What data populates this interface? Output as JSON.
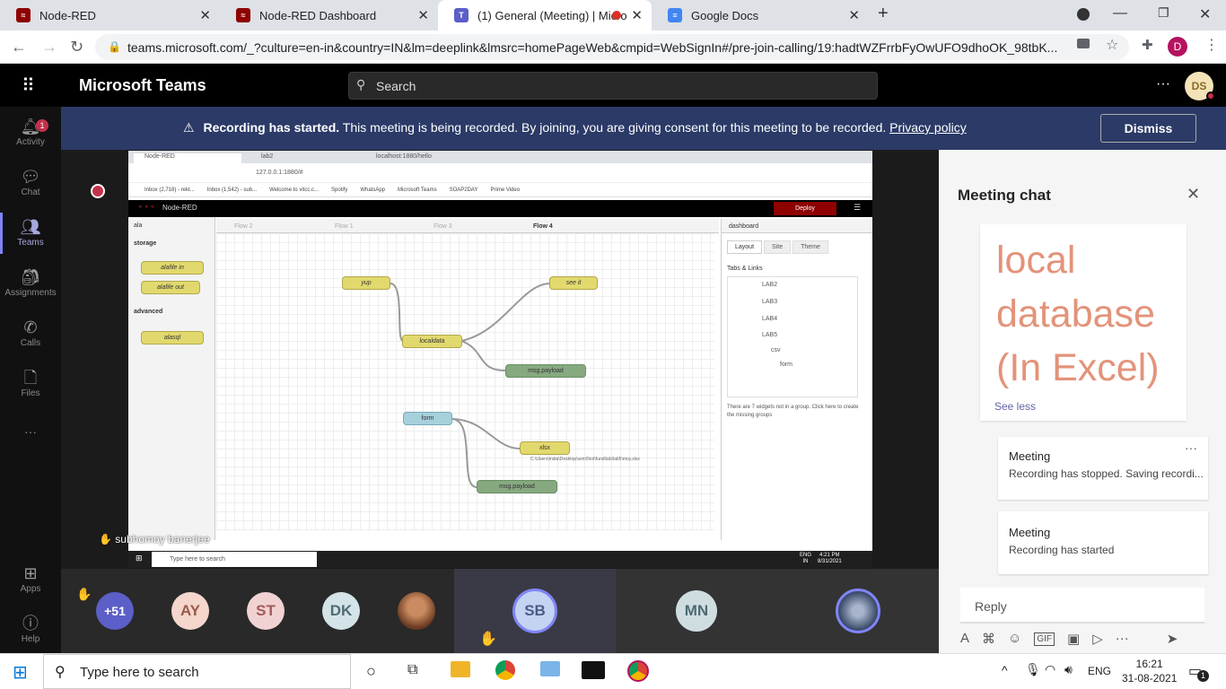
{
  "browser": {
    "tabs": [
      {
        "title": "Node-RED",
        "active": false
      },
      {
        "title": "Node-RED Dashboard",
        "active": false
      },
      {
        "title": "(1) General (Meeting) | Micro",
        "active": true
      },
      {
        "title": "Google Docs",
        "active": false
      }
    ],
    "url": "teams.microsoft.com/_?culture=en-in&country=IN&lm=deeplink&lmsrc=homePageWeb&cmpid=WebSignIn#/pre-join-calling/19:hadtWZFrrbFyOwUFO9dhoOK_98tbK...",
    "profile_initial": "D"
  },
  "teams": {
    "app_title": "Microsoft Teams",
    "search_placeholder": "Search",
    "more": "···",
    "user_initials": "DS",
    "rail": [
      {
        "label": "Activity",
        "badge": "1"
      },
      {
        "label": "Chat"
      },
      {
        "label": "Teams"
      },
      {
        "label": "Assignments"
      },
      {
        "label": "Calls"
      },
      {
        "label": "Files"
      },
      {
        "label": "···"
      },
      {
        "label": "Apps"
      },
      {
        "label": "Help"
      }
    ]
  },
  "banner": {
    "bold": "Recording has started.",
    "text": " This meeting is being recorded. By joining, you are giving consent for this meeting to be recorded. ",
    "link": "Privacy policy",
    "dismiss": "Dismiss"
  },
  "shared_screen": {
    "presenter": "subhomoy banerjee",
    "inner_tabs": [
      "Node-RED",
      "lab2",
      "localhost:1880/hello"
    ],
    "inner_url": "127.0.0.1:1880/#",
    "bookmarks": [
      "Inbox (2,718) - rekt...",
      "Inbox (1,542) - sub...",
      "Welcome to vitcc.c...",
      "Spotify",
      "WhatsApp",
      "Microsoft Teams",
      "SOAP2DAY",
      "Prime Video"
    ],
    "nodered_title": "Node-RED",
    "deploy": "Deploy",
    "palette_search": "ala",
    "palette_sections": [
      {
        "name": "storage",
        "nodes": [
          "alafile in",
          "alafile out"
        ]
      },
      {
        "name": "advanced",
        "nodes": [
          "alasql"
        ]
      }
    ],
    "flow_tabs": [
      "Flow 2",
      "Flow 1",
      "Flow 3",
      "Flow 4"
    ],
    "nodes": {
      "yup": "yup",
      "see_it": "see it",
      "localdata": "localdata",
      "msg_payload_1": "msg.payload",
      "form": "form",
      "xlsx": "xlsx",
      "xlsx_path": "C:\\Users\\india\\Desktop\\sem5\\iot\\fund\\lab\\lab5\\moy.xlsx",
      "msg_payload_2": "msg.payload"
    },
    "dashboard": {
      "title": "dashboard",
      "tabs": [
        "Layout",
        "Site",
        "Theme"
      ],
      "section": "Tabs & Links",
      "tree": [
        "LAB2",
        "LAB3",
        "LAB4",
        "LAB5",
        "csv",
        "form"
      ],
      "note": "There are 7 widgets not in a group. Click here to create the missing groups"
    },
    "inner_taskbar": {
      "search": "Type here to search",
      "lang": "ENG",
      "region": "IN",
      "time": "4:21 PM",
      "date": "8/31/2021"
    }
  },
  "participants": [
    {
      "label": "+51",
      "color": "#5b5fc7"
    },
    {
      "label": "AY",
      "color": "#f4d6cc"
    },
    {
      "label": "ST",
      "color": "#f1d2d2"
    },
    {
      "label": "DK",
      "color": "#d4e3e7"
    },
    {
      "label": "",
      "color": "#8a5a3a"
    },
    {
      "label": "SB",
      "color": "#c5d3f2"
    },
    {
      "label": "MN",
      "color": "#cfdde1"
    },
    {
      "label": "",
      "color": "#6b7c99"
    }
  ],
  "chat": {
    "title": "Meeting chat",
    "big_message": "local database (In Excel)",
    "see_less": "See less",
    "cards": [
      {
        "title": "Meeting",
        "body": "Recording has stopped. Saving recordi...",
        "more": "···"
      },
      {
        "title": "Meeting",
        "body": "Recording has started"
      }
    ],
    "reply_placeholder": "Reply"
  },
  "os_taskbar": {
    "search": "Type here to search",
    "lang": "ENG",
    "time": "16:21",
    "date": "31-08-2021",
    "notification_count": "1"
  },
  "colors": {
    "banner": "#2b3a67",
    "accent": "#6264a7",
    "nodered_header": "#8f0000",
    "chat_big_text": "#e3937a"
  }
}
